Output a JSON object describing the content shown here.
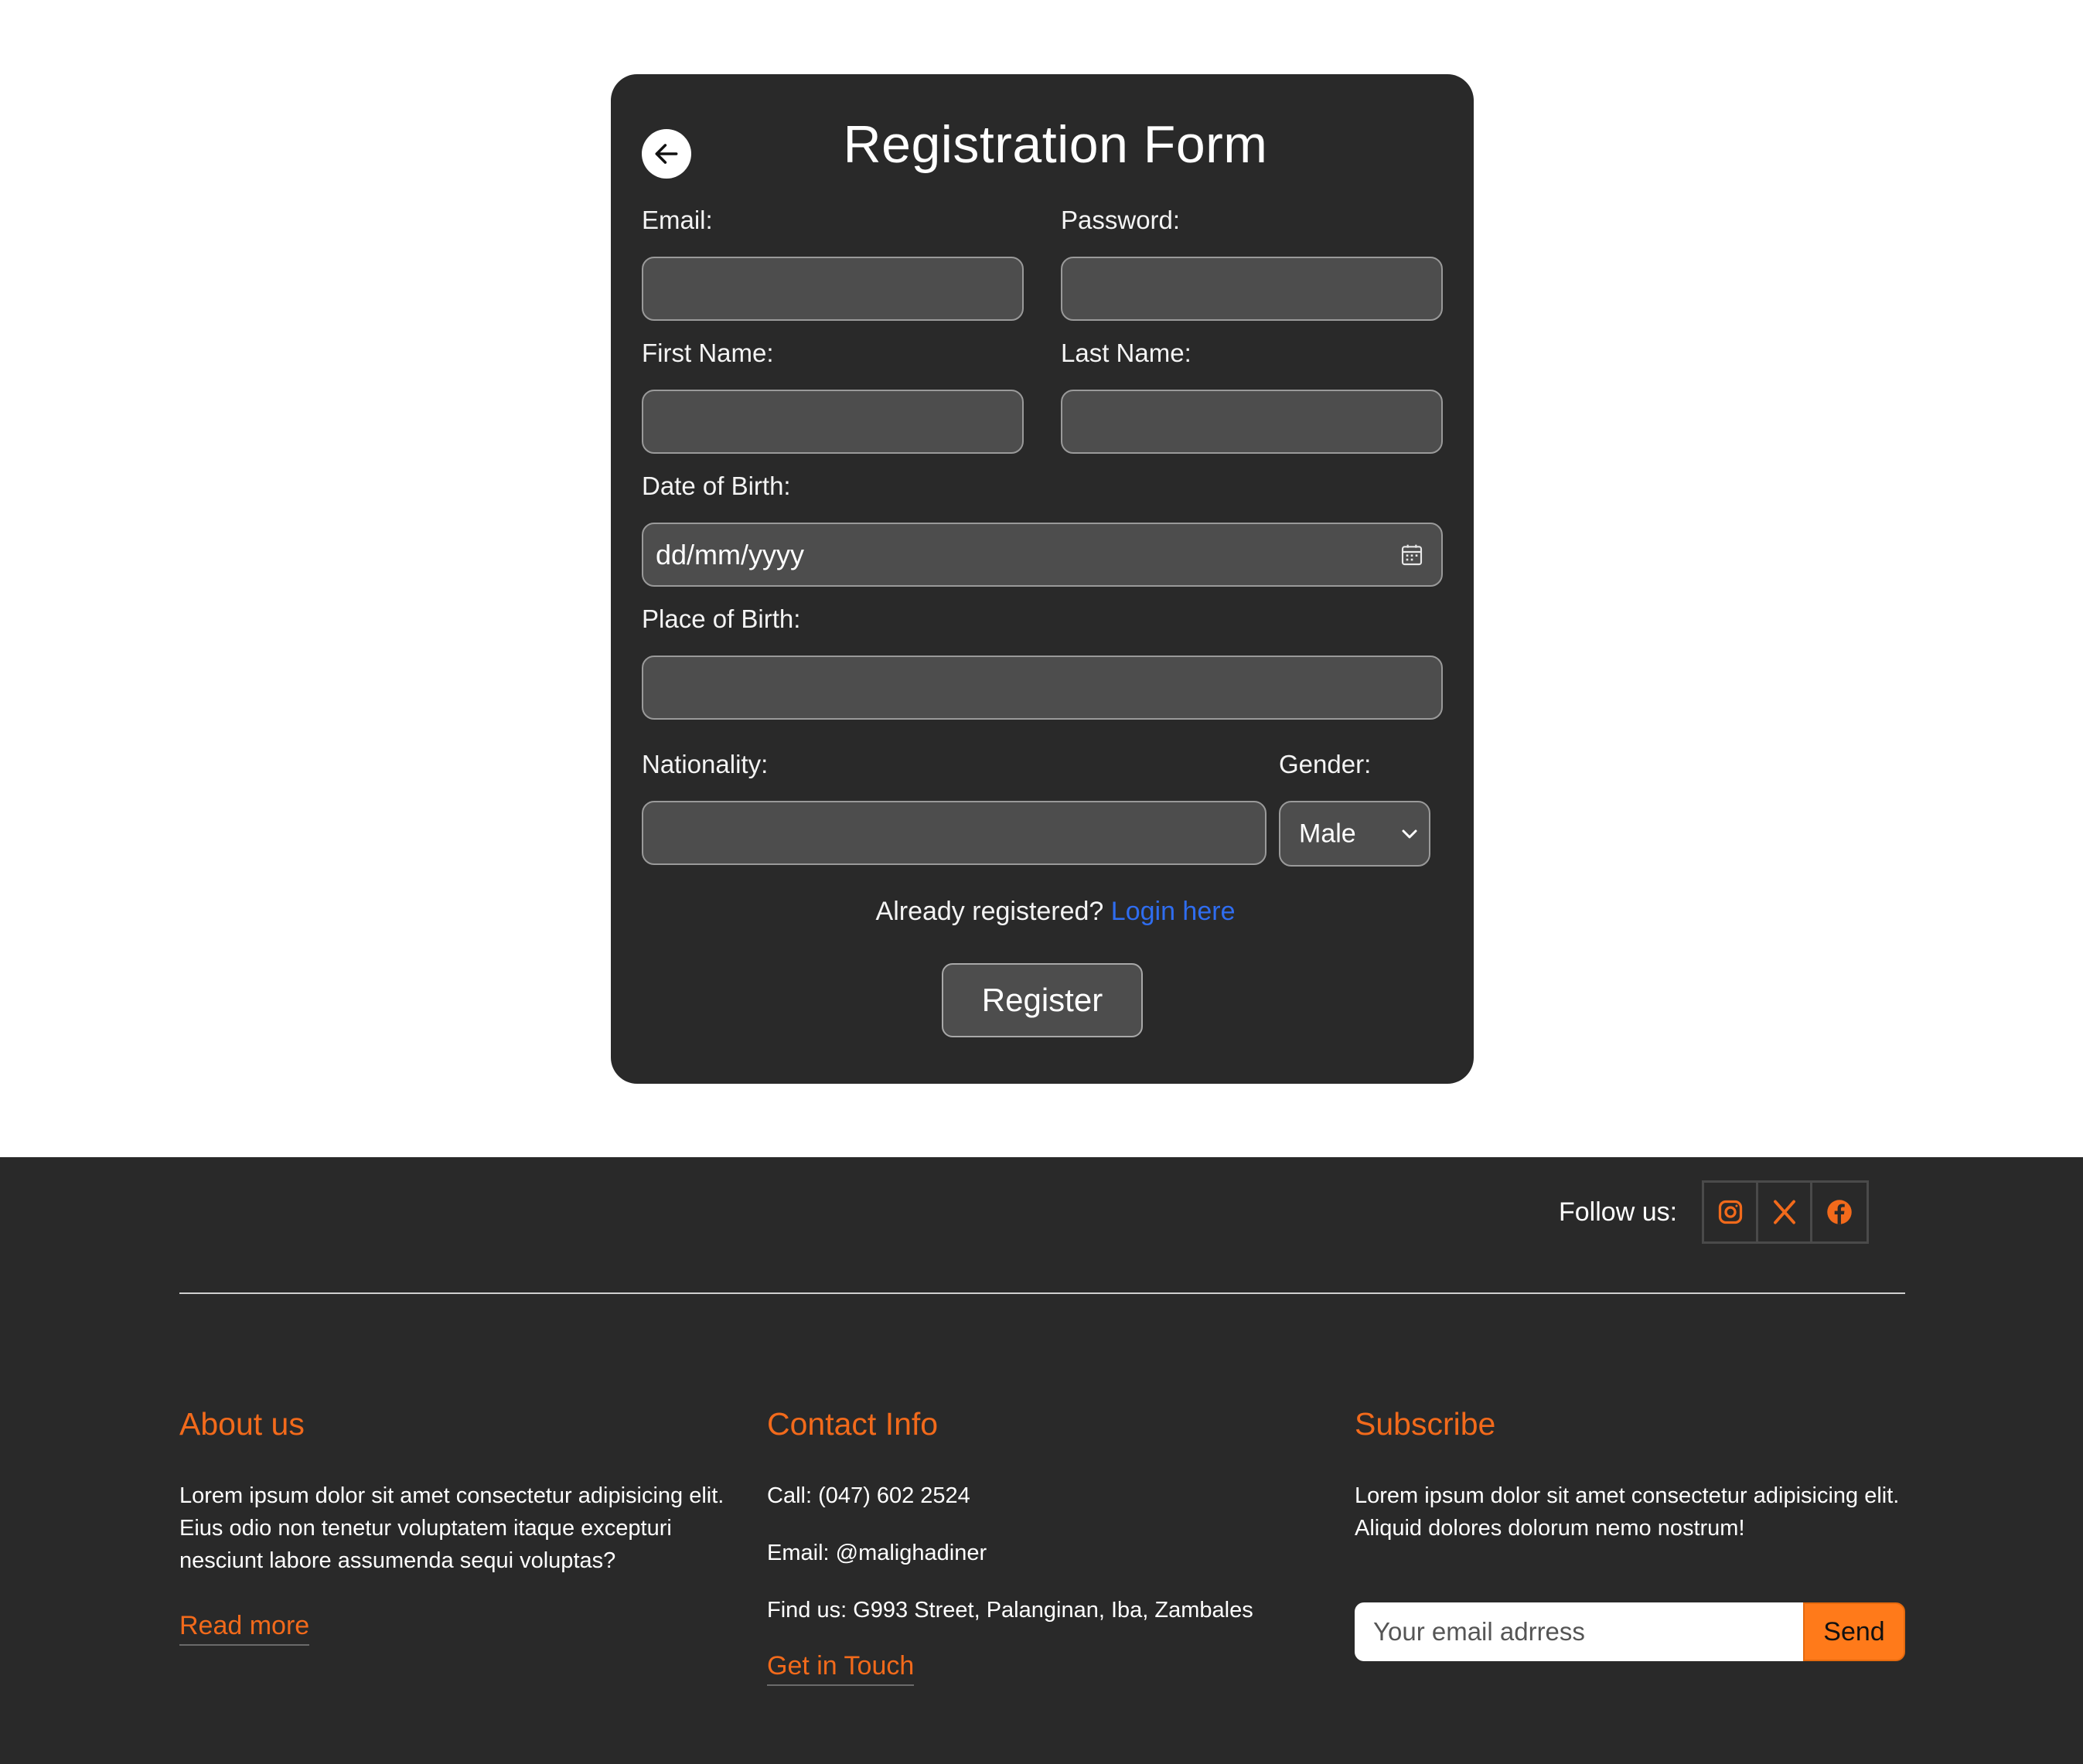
{
  "form": {
    "title": "Registration Form",
    "back_icon": "arrow-left-icon",
    "email_label": "Email:",
    "password_label": "Password:",
    "first_name_label": "First Name:",
    "last_name_label": "Last Name:",
    "dob_label": "Date of Birth:",
    "dob_placeholder": "dd/mm/yyyy",
    "pob_label": "Place of Birth:",
    "nationality_label": "Nationality:",
    "gender_label": "Gender:",
    "gender_value": "Male",
    "already_text": "Already registered?",
    "login_link": "Login here",
    "register_label": "Register"
  },
  "footer": {
    "follow_label": "Follow us:",
    "social_icons": [
      "instagram-icon",
      "x-icon",
      "facebook-icon"
    ],
    "about": {
      "heading": "About us",
      "text": "Lorem ipsum dolor sit amet consectetur adipisicing elit. Eius odio non tenetur voluptatem itaque excepturi nesciunt labore assumenda sequi voluptas?",
      "link": "Read more"
    },
    "contact": {
      "heading": "Contact Info",
      "call": "Call: (047) 602 2524",
      "email": "Email: @malighadiner",
      "address": "Find us: G993 Street, Palanginan, Iba, Zambales",
      "link": "Get in Touch"
    },
    "subscribe": {
      "heading": "Subscribe",
      "text": "Lorem ipsum dolor sit amet consectetur adipisicing elit. Aliquid dolores dolorum nemo nostrum!",
      "placeholder": "Your email adrress",
      "button": "Send"
    }
  },
  "colors": {
    "card_bg": "#292929",
    "field_bg": "#4d4d4d",
    "accent_orange": "#f26a1b",
    "link_blue": "#2f6df0"
  }
}
